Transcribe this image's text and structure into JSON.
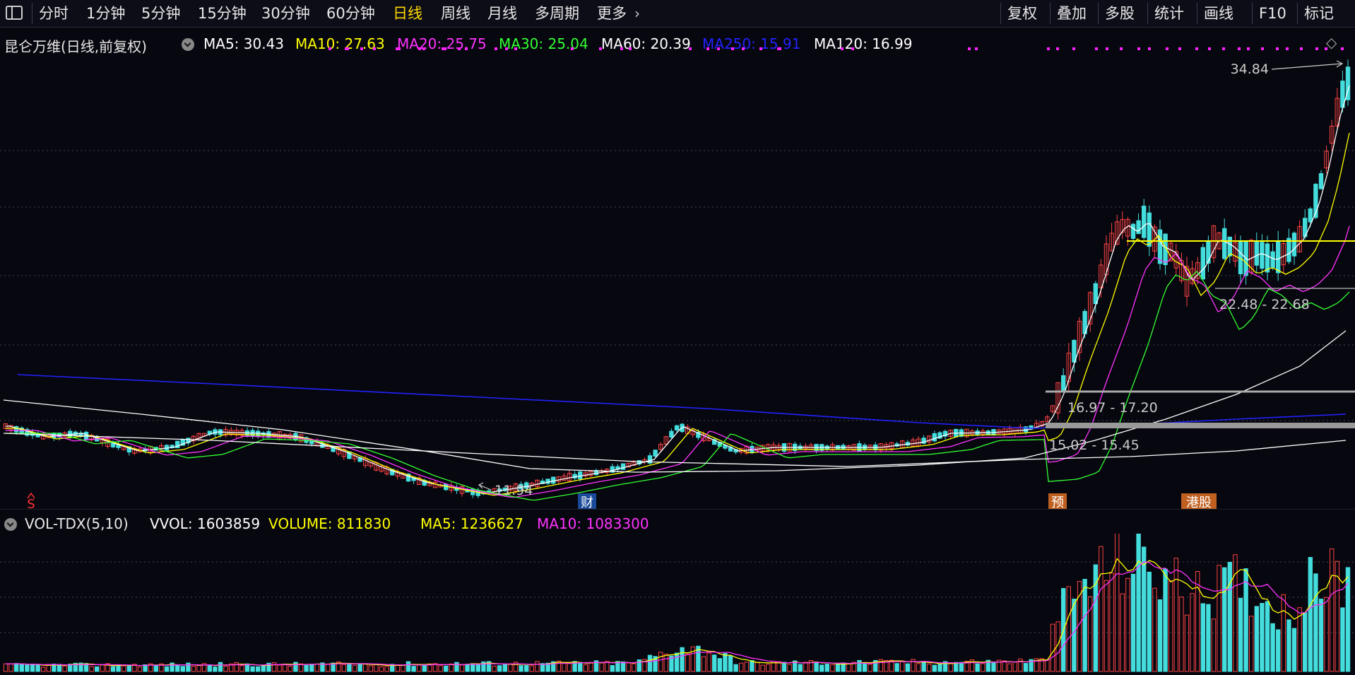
{
  "toolbar": {
    "periods": [
      "分时",
      "1分钟",
      "5分钟",
      "15分钟",
      "30分钟",
      "60分钟",
      "日线",
      "周线",
      "月线",
      "多周期",
      "更多"
    ],
    "active": "日线",
    "right_items": [
      "复权",
      "叠加",
      "多股",
      "统计",
      "画线",
      "F10",
      "标记"
    ]
  },
  "main_header": {
    "stock_title": "昆仑万维(日线,前复权)",
    "ma_items": [
      {
        "label": "MA5: 30.43",
        "color": "#ffffff"
      },
      {
        "label": "MA10: 27.63",
        "color": "#ffff00"
      },
      {
        "label": "MA20: 25.75",
        "color": "#ff33ff"
      },
      {
        "label": "MA30: 25.04",
        "color": "#33ff33"
      },
      {
        "label": "MA60: 20.39",
        "color": "#ffffff"
      },
      {
        "label": "MA250: 15.91",
        "color": "#2222ff"
      },
      {
        "label": "MA120: 16.99",
        "color": "#ffffff"
      }
    ]
  },
  "vol_header": {
    "indicator": "VOL-TDX(5,10)",
    "items": [
      {
        "label": "VVOL: 1603859",
        "color": "#ffffff"
      },
      {
        "label": "VOLUME: 811830",
        "color": "#ffff00"
      },
      {
        "label": "MA5: 1236627",
        "color": "#ffff00"
      },
      {
        "label": "MA10: 1083300",
        "color": "#ff33ff"
      }
    ]
  },
  "chart_data": [
    {
      "type": "candlestick",
      "title": "昆仑万维(日线,前复权)",
      "ylim": [
        10,
        36
      ],
      "annotations": {
        "high_label": "34.84",
        "low_label": "11.94",
        "ranges": [
          "22.48 - 22.68",
          "16.97 - 17.20",
          "15.02 - 15.45"
        ]
      },
      "event_markers": [
        "S",
        "财",
        "预",
        "港股"
      ],
      "series": [
        {
          "name": "MA5",
          "color": "#ffffff",
          "last": 30.43
        },
        {
          "name": "MA10",
          "color": "#ffff00",
          "last": 27.63
        },
        {
          "name": "MA20",
          "color": "#ff33ff",
          "last": 25.75
        },
        {
          "name": "MA30",
          "color": "#33ff33",
          "last": 25.04
        },
        {
          "name": "MA60",
          "color": "#ffffff",
          "last": 20.39
        },
        {
          "name": "MA250",
          "color": "#2222ff",
          "last": 15.91
        },
        {
          "name": "MA120",
          "color": "#ffffff",
          "last": 16.99
        }
      ]
    },
    {
      "type": "bar",
      "title": "VOL-TDX(5,10)",
      "series": [
        {
          "name": "VOLUME",
          "color": "#ffff00",
          "last": 811830
        },
        {
          "name": "MA5",
          "color": "#ffff00",
          "last": 1236627
        },
        {
          "name": "MA10",
          "color": "#ff33ff",
          "last": 1083300
        }
      ]
    }
  ]
}
